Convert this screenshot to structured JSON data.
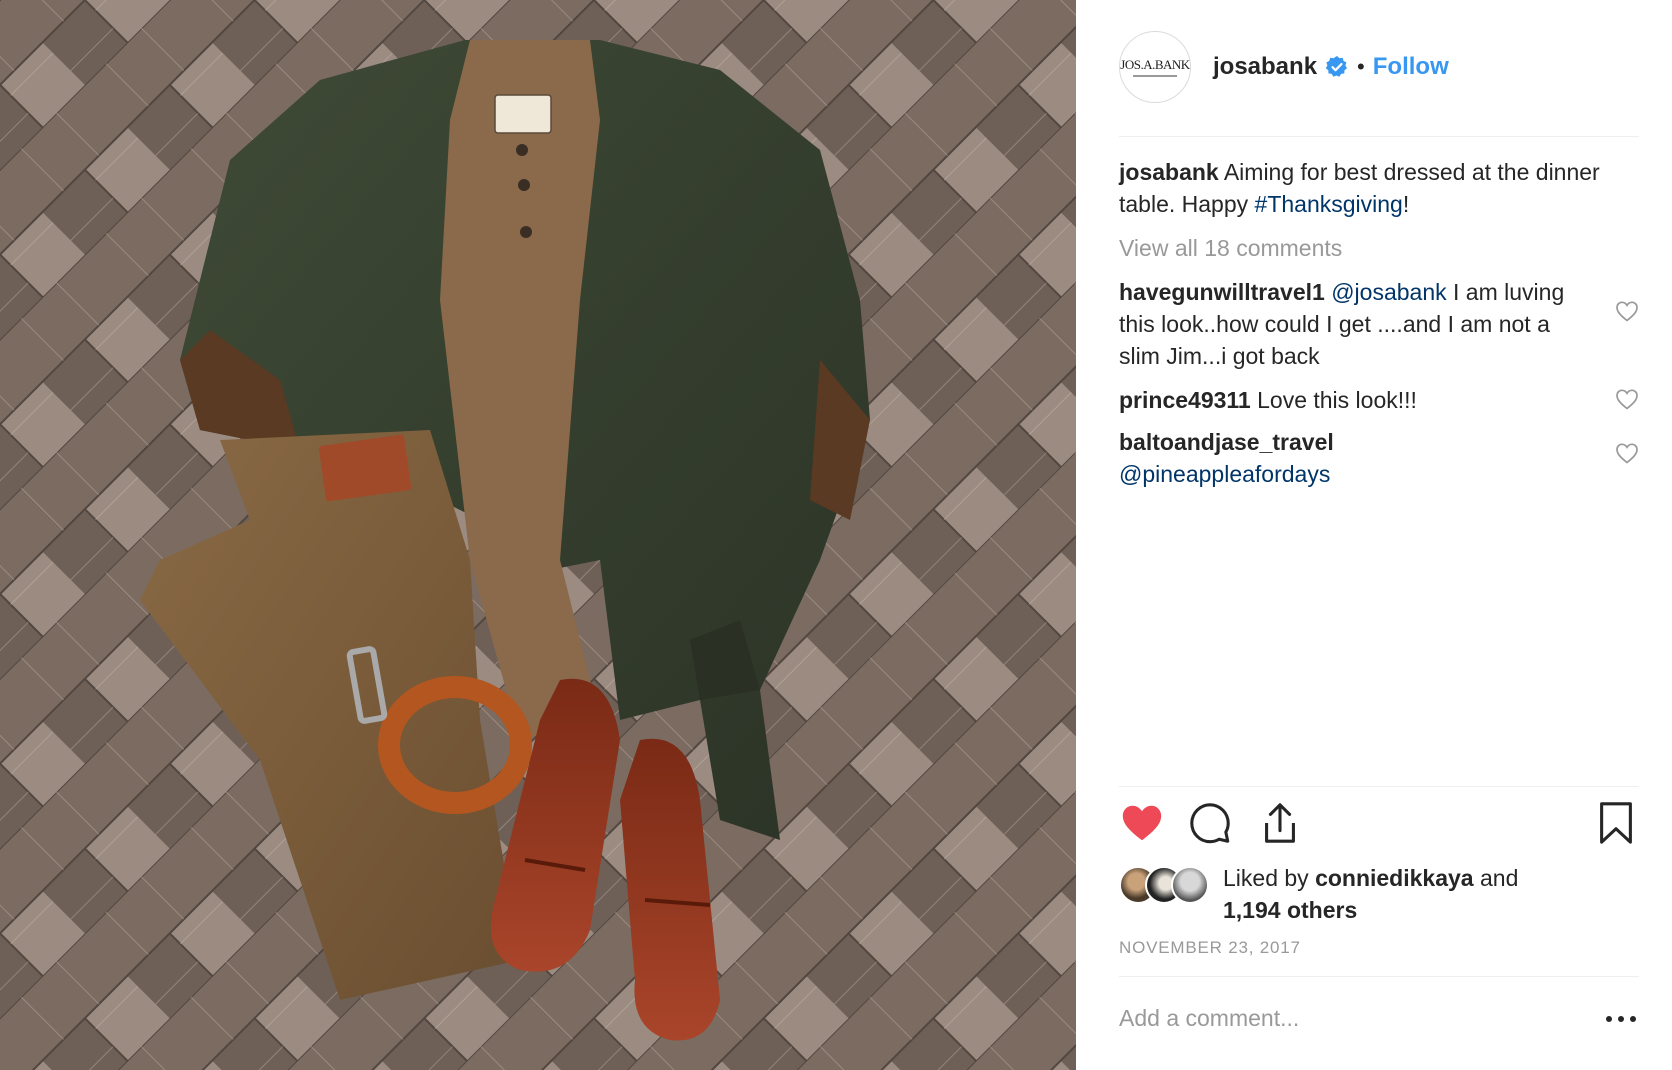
{
  "post": {
    "account": {
      "username": "josabank",
      "avatar_text": "JOS.A.BANK",
      "verified_icon": "verified-badge-icon",
      "separator": "•",
      "follow_label": "Follow"
    },
    "caption": {
      "username": "josabank",
      "text_before": " Aiming for best dressed at the dinner table. Happy ",
      "hashtag": "#Thanksgiving",
      "text_after": "!"
    },
    "view_all_comments": "View all 18 comments",
    "comments": [
      {
        "user": "havegunwilltravel1",
        "mention": "@josabank",
        "text": " I am luving this look..how could I get ....and I am not a slim Jim...i got back"
      },
      {
        "user": "prince49311",
        "mention": "",
        "text": " Love this look!!!"
      },
      {
        "user": "baltoandjase_travel",
        "mention": "@pineappleafordays",
        "text": ""
      }
    ],
    "likes": {
      "prefix": "Liked by ",
      "first_user": "conniedikkaya",
      "middle": " and ",
      "others": "1,194 others"
    },
    "date": "NOVEMBER 23, 2017",
    "add_comment_placeholder": "Add a comment...",
    "liked": true
  },
  "colors": {
    "link_blue": "#3897f0",
    "hashtag_blue": "#003569",
    "heart_red": "#ed4956",
    "muted_gray": "#999999",
    "text": "#262626"
  },
  "icons": {
    "like": "heart-filled-icon",
    "comment": "speech-bubble-icon",
    "share": "share-upload-icon",
    "save": "bookmark-icon",
    "more": "more-dots-icon",
    "comment_like": "heart-outline-icon"
  }
}
